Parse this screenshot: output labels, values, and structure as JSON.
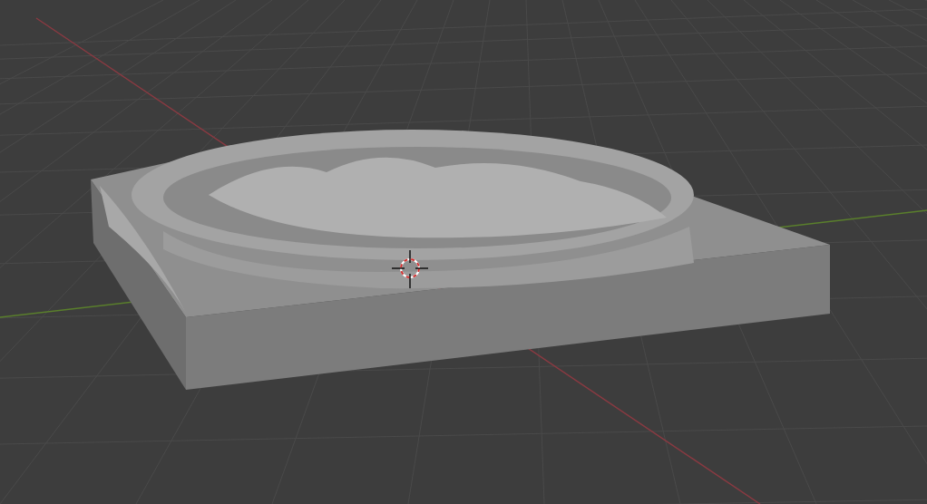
{
  "viewport": {
    "grid": true,
    "axes": true,
    "cursor": true
  }
}
